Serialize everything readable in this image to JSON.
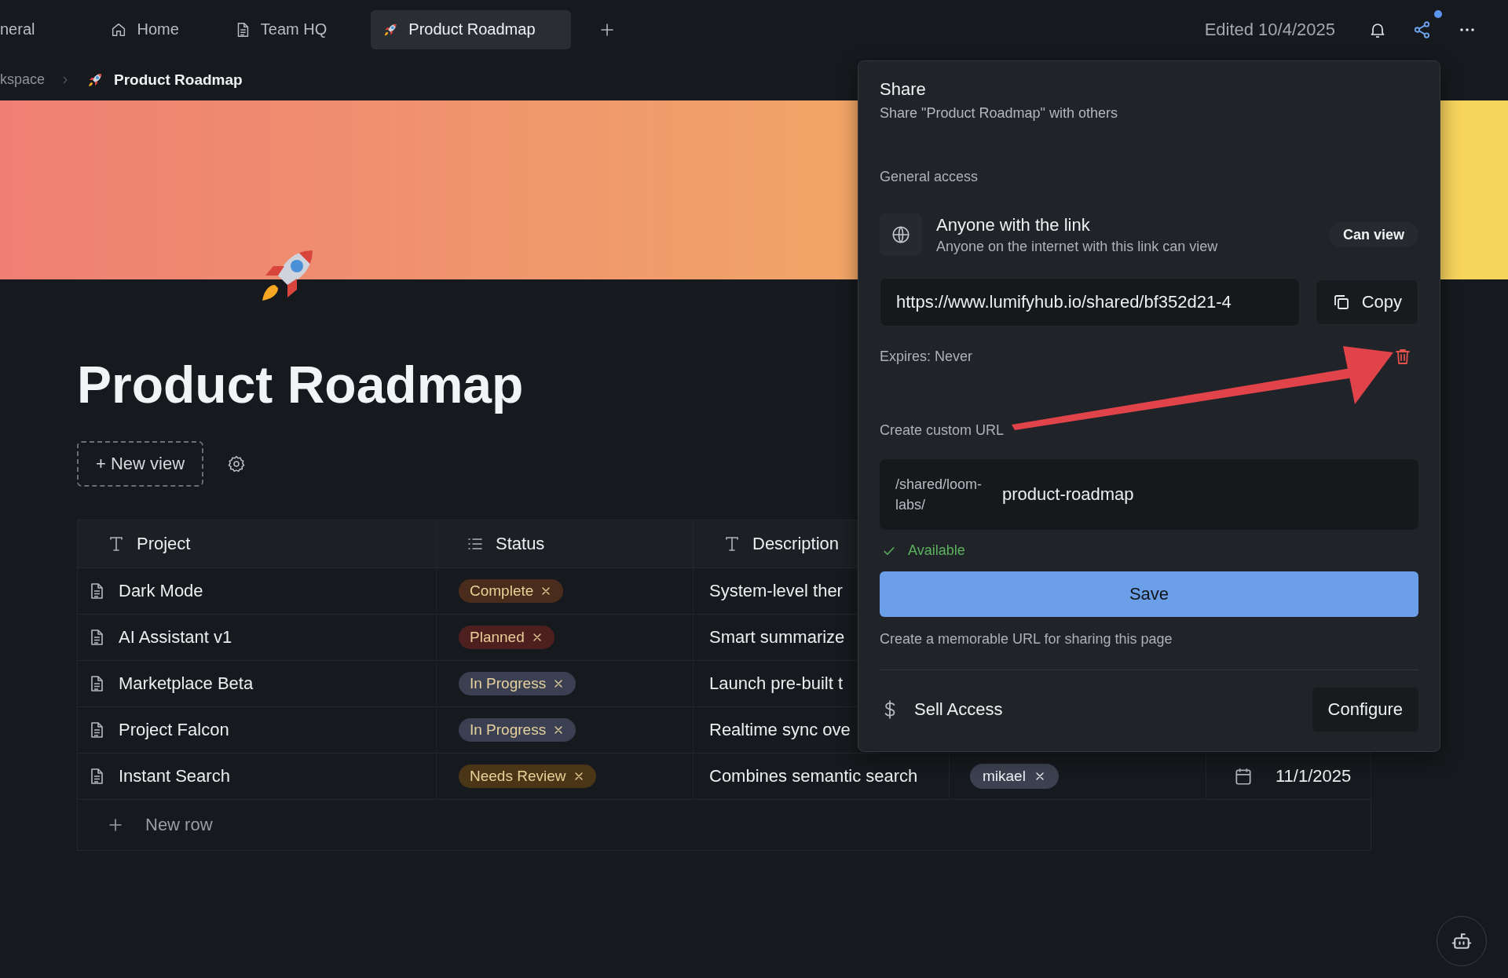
{
  "tabs": [
    {
      "label": "neral",
      "kind": "plain",
      "selected": false
    },
    {
      "label": "Home",
      "kind": "home",
      "selected": false
    },
    {
      "label": "Team HQ",
      "kind": "page",
      "selected": false
    },
    {
      "label": "Product Roadmap",
      "kind": "project",
      "selected": true
    }
  ],
  "edited": "Edited 10/4/2025",
  "share_unread": true,
  "breadcrumb": [
    {
      "label": "kspace",
      "kind": "plain"
    },
    {
      "label": "Product Roadmap",
      "kind": "project"
    }
  ],
  "page": {
    "title": "Product Roadmap",
    "new_view": "+ New view"
  },
  "table": {
    "columns": [
      {
        "label": "Project",
        "kind": "text"
      },
      {
        "label": "Status",
        "kind": "select"
      },
      {
        "label": "Description",
        "kind": "text"
      }
    ],
    "rows": [
      {
        "project": "Dark Mode",
        "status": {
          "label": "Complete",
          "color": "#4a2c1c"
        },
        "description": "System-level ther"
      },
      {
        "project": "AI Assistant v1",
        "status": {
          "label": "Planned",
          "color": "#4e1f1f"
        },
        "description": "Smart summarize"
      },
      {
        "project": "Marketplace Beta",
        "status": {
          "label": "In Progress",
          "color": "#3a4052"
        },
        "description": "Launch pre-built t"
      },
      {
        "project": "Project Falcon",
        "status": {
          "label": "In Progress",
          "color": "#3a4052"
        },
        "description": "Realtime sync ove"
      },
      {
        "project": "Instant Search",
        "status": {
          "label": "Needs Review",
          "color": "#4a3517"
        },
        "description": "Combines semantic search",
        "assignee": "mikael",
        "date": "11/1/2025"
      }
    ],
    "new_row": "New row"
  },
  "share": {
    "title": "Share",
    "subtitle": "Share \"Product Roadmap\" with others",
    "general_access_label": "General access",
    "access": {
      "title": "Anyone with the link",
      "description": "Anyone on the internet with this link can view",
      "permission": "Can view"
    },
    "link": "https://www.lumifyhub.io/shared/bf352d21-4",
    "copy": "Copy",
    "expires": "Expires: Never",
    "custom_url_label": "Create custom URL",
    "custom_url": {
      "prefix": "/shared/loom-labs/",
      "value": "product-roadmap"
    },
    "availability": "Available",
    "save": "Save",
    "hint": "Create a memorable URL for sharing this page",
    "sell_access": "Sell Access",
    "configure": "Configure"
  }
}
